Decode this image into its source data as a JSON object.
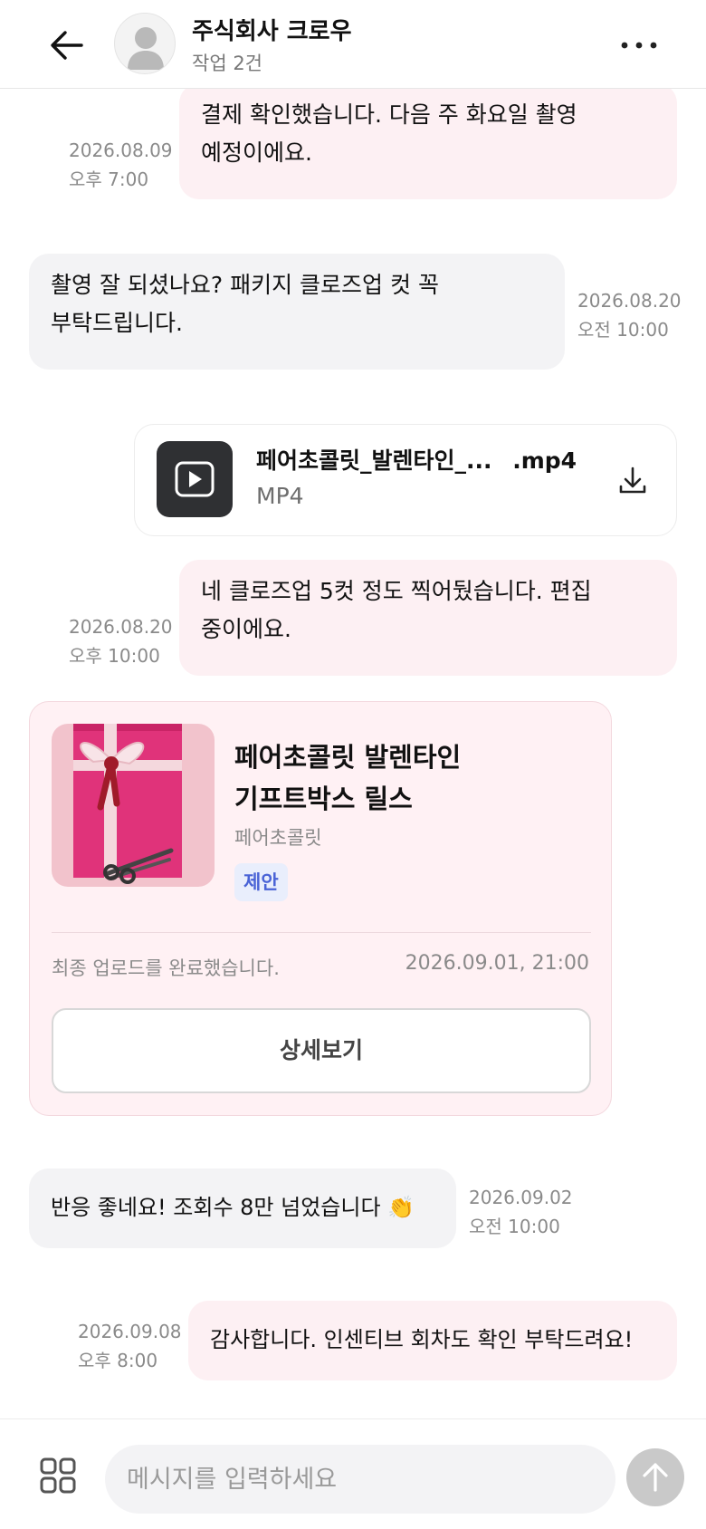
{
  "header": {
    "title": "주식회사 크로우",
    "subtitle": "작업 2건"
  },
  "messages": [
    {
      "id": 1,
      "side": "me",
      "text": "결제 확인했습니다. 다음 주 화요일 촬영 예정이에요.",
      "date": "2026.08.09",
      "time": "오후 7:00"
    },
    {
      "id": 2,
      "side": "them",
      "text": "촬영 잘 되셨나요? 패키지 클로즈업 컷 꼭 부탁드립니다.",
      "date": "2026.08.20",
      "time": "오전 10:00"
    },
    {
      "id": 3,
      "side": "me",
      "text": "네 클로즈업 5컷 정도 찍어뒀습니다. 편집 중이에요.",
      "date": "2026.08.20",
      "time": "오후 10:00"
    },
    {
      "id": 4,
      "side": "them",
      "text": "반응 좋네요! 조회수 8만 넘었습니다 👏",
      "date": "2026.09.02",
      "time": "오전 10:00"
    },
    {
      "id": 5,
      "side": "me",
      "text": "감사합니다. 인센티브 회차도 확인 부탁드려요!",
      "date": "2026.09.08",
      "time": "오후 8:00"
    }
  ],
  "file": {
    "name_start": "페어초콜릿_발렌타인_...",
    "name_ext": ".mp4",
    "type": "MP4",
    "icon": "play-icon"
  },
  "product_card": {
    "title": "페어초콜릿 발렌타인 기프트박스 릴스",
    "seller": "페어초콜릿",
    "badge": "제안",
    "status": "최종 업로드를 완료했습니다.",
    "date": "2026.09.01, 21:00",
    "button_label": "상세보기"
  },
  "input": {
    "placeholder": "메시지를 입력하세요"
  },
  "colors": {
    "my_bubble": "#fdf0f3",
    "their_bubble": "#f3f3f5",
    "card_bg": "#fff1f4",
    "badge_text": "#4a63d6",
    "send_button": "#c9c9c9"
  }
}
